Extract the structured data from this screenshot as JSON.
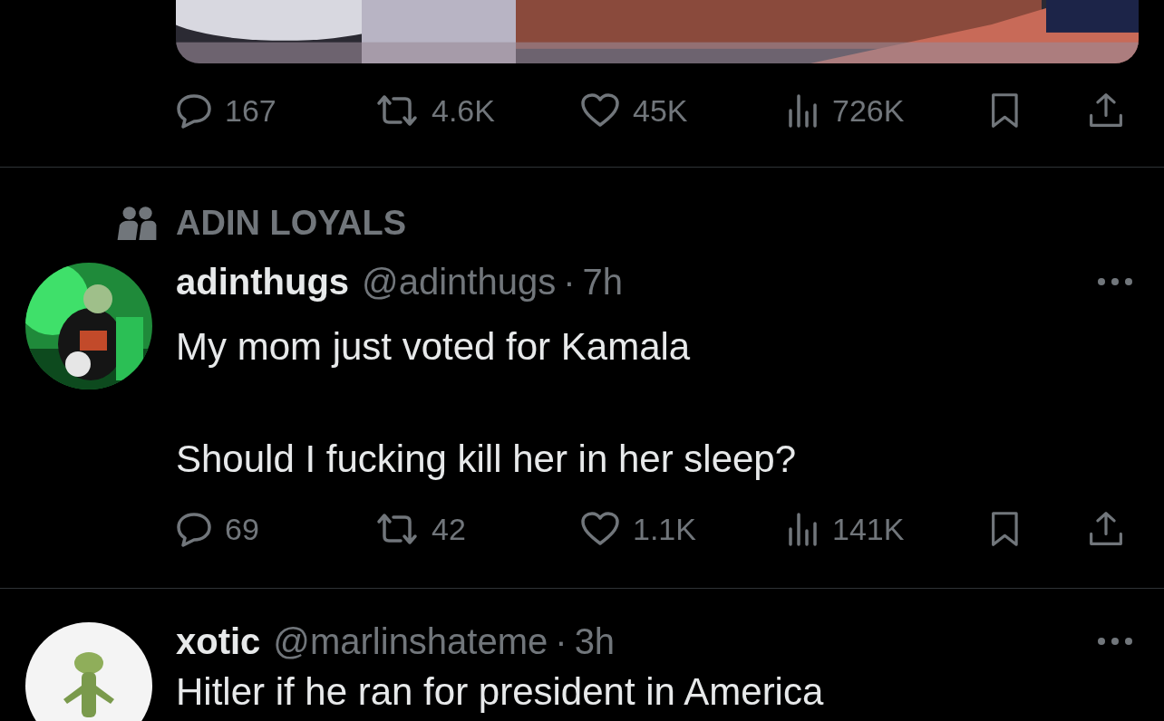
{
  "posts": [
    {
      "media": {
        "kind": "picture"
      },
      "actions": [
        {
          "kind": "reply",
          "count": "167"
        },
        {
          "kind": "repost",
          "count": "4.6K"
        },
        {
          "kind": "like",
          "count": "45K"
        },
        {
          "kind": "views",
          "count": "726K"
        },
        {
          "kind": "bookmark"
        },
        {
          "kind": "share"
        }
      ]
    },
    {
      "community": "ADIN LOYALS",
      "avatar": {
        "kind": "picture"
      },
      "name": "adinthugs",
      "handle": "@adinthugs",
      "dot": "·",
      "time": "7h",
      "paragraphs": [
        "My mom just voted for Kamala",
        "Should I fucking kill her in her sleep?"
      ],
      "actions": [
        {
          "kind": "reply",
          "count": "69"
        },
        {
          "kind": "repost",
          "count": "42"
        },
        {
          "kind": "like",
          "count": "1.1K"
        },
        {
          "kind": "views",
          "count": "141K"
        },
        {
          "kind": "bookmark"
        },
        {
          "kind": "share"
        }
      ]
    },
    {
      "avatar": {
        "kind": "picture"
      },
      "name": "xotic",
      "handle": "@marlinshateme",
      "dot": "·",
      "time": "3h",
      "paragraphs": [
        "Hitler if he ran for president in America"
      ]
    }
  ]
}
